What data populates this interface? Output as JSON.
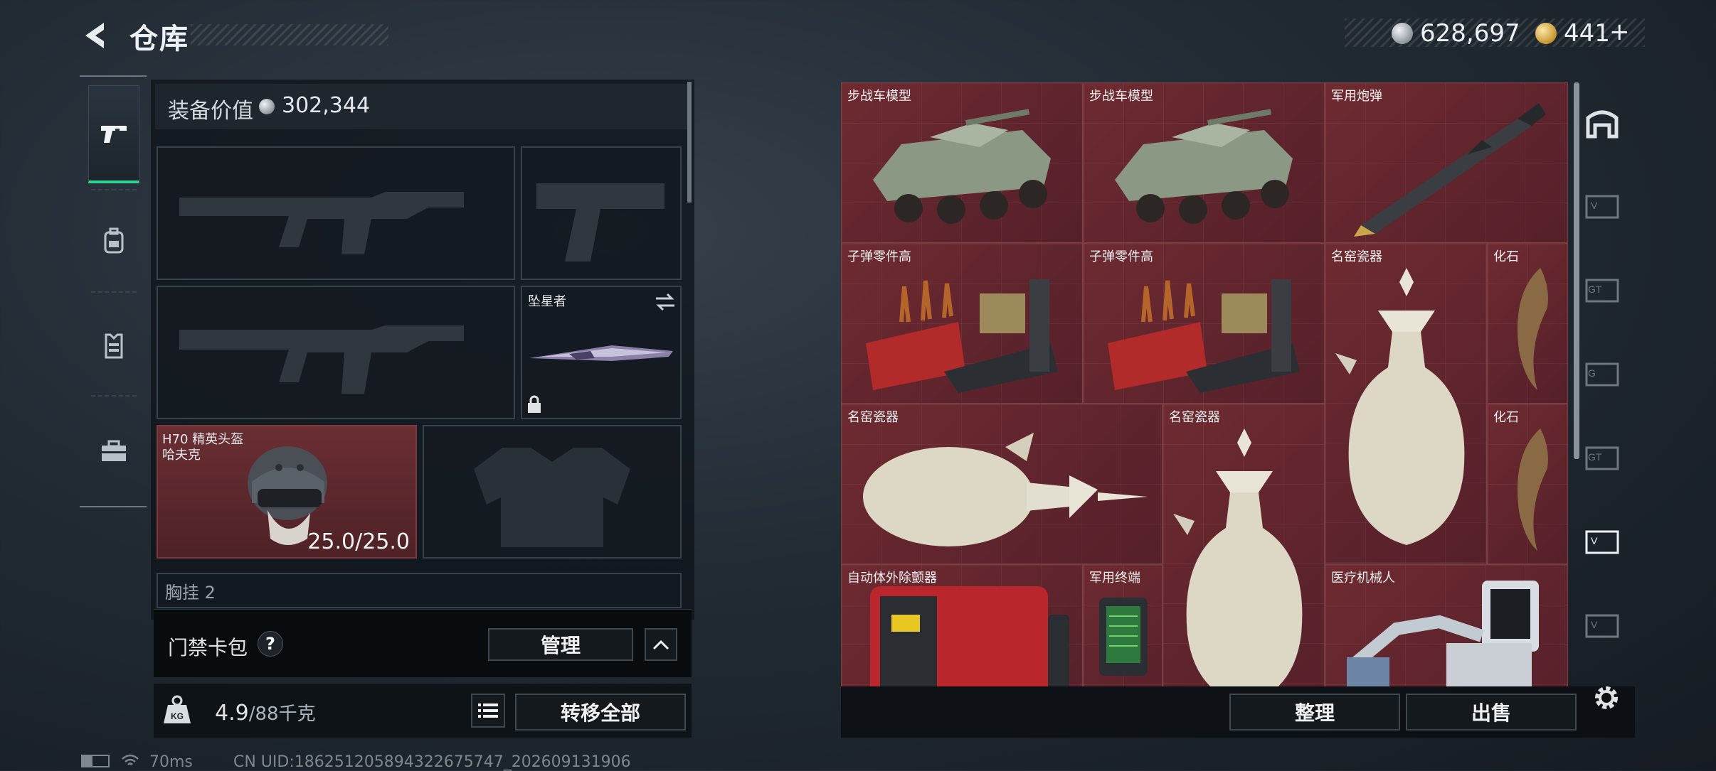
{
  "header": {
    "title": "仓库",
    "currency_silver": "628,697",
    "currency_gold": "441",
    "currency_gold_add": "+"
  },
  "tabs": [
    {
      "icon": "pistol-icon",
      "active": true
    },
    {
      "icon": "backpack-icon",
      "active": false
    },
    {
      "icon": "vest-icon",
      "active": false
    },
    {
      "icon": "toolbox-icon",
      "active": false
    }
  ],
  "loadout": {
    "value_label": "装备价值",
    "value": "302,344",
    "melee_name": "坠星者",
    "helmet_name": "H70 精英头盔",
    "helmet_brand": "哈夫克",
    "helmet_durability": "25.0/25.0",
    "next_section_partial": "胸挂  2"
  },
  "access_card": {
    "label": "门禁卡包",
    "help": "?",
    "manage": "管理"
  },
  "capacity": {
    "current": "4.9",
    "max_unit": "/88千克",
    "transfer_all": "转移全部",
    "kg_badge": "KG"
  },
  "storage_items": [
    {
      "label": "步战车模型"
    },
    {
      "label": "步战车模型"
    },
    {
      "label": "军用炮弹"
    },
    {
      "label": "子弹零件高"
    },
    {
      "label": "子弹零件高"
    },
    {
      "label": "名窑瓷器"
    },
    {
      "label": "化石"
    },
    {
      "label": "名窑瓷器"
    },
    {
      "label": "名窑瓷器"
    },
    {
      "label": "化石"
    },
    {
      "label": "自动体外除颤器"
    },
    {
      "label": "军用终端"
    },
    {
      "label": "医疗机械人"
    }
  ],
  "storage_actions": {
    "sort": "整理",
    "sell": "出售"
  },
  "status_bar": {
    "ping": "70ms",
    "uid": "CN UID:1862512058943226757​47_202609131906"
  },
  "colors": {
    "item_bg": "#6e2a31",
    "accent_green": "#2fd38f",
    "panel": "#0e1318"
  }
}
